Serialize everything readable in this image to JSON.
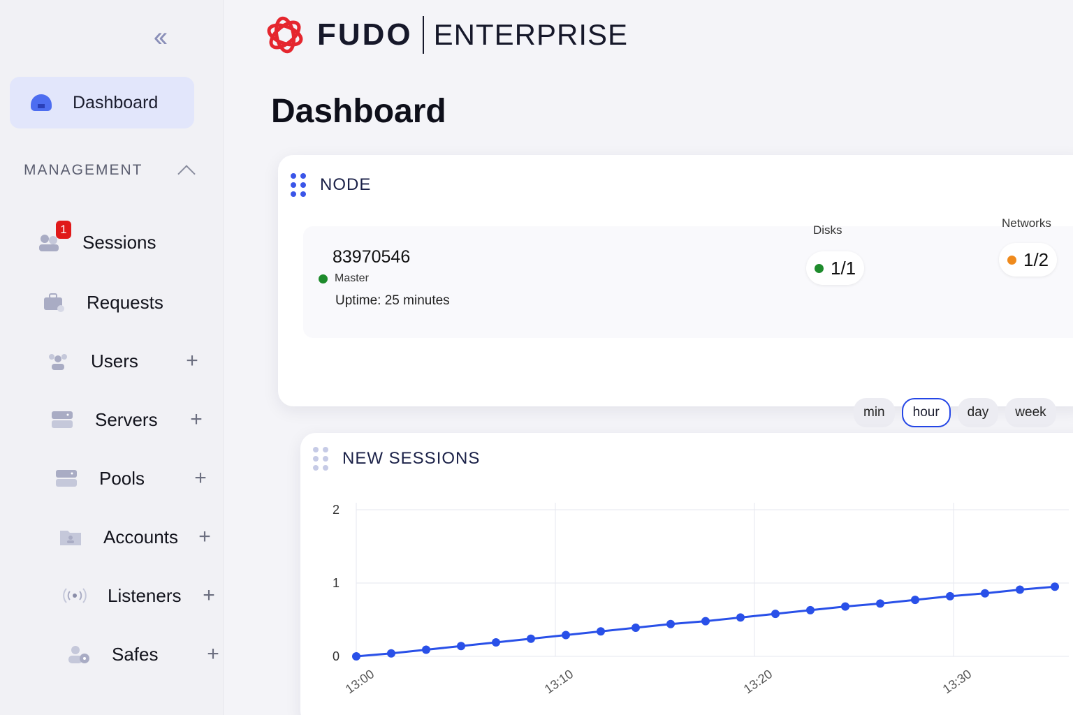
{
  "sidebar": {
    "dashboard_label": "Dashboard",
    "section_title": "MANAGEMENT",
    "items": [
      {
        "label": "Sessions",
        "badge": "1",
        "plus": ""
      },
      {
        "label": "Requests",
        "plus": ""
      },
      {
        "label": "Users",
        "plus": "+"
      },
      {
        "label": "Servers",
        "plus": "+"
      },
      {
        "label": "Pools",
        "plus": "+"
      },
      {
        "label": "Accounts",
        "plus": "+"
      },
      {
        "label": "Listeners",
        "plus": "+"
      },
      {
        "label": "Safes",
        "plus": "+"
      }
    ],
    "collapse_icon": "double-chevron-left-icon"
  },
  "header": {
    "brand": "FUDO",
    "edition": "ENTERPRISE",
    "accent": "#e5262e"
  },
  "page": {
    "title": "Dashboard"
  },
  "node": {
    "title": "NODE",
    "id": "83970546",
    "role": "Master",
    "uptime": "Uptime: 25 minutes",
    "disks_label": "Disks",
    "disks_value": "1/1",
    "disks_status": "#1e8b2c",
    "networks_label": "Networks",
    "networks_value": "1/2",
    "networks_status": "#ef8a1c"
  },
  "range": {
    "options": [
      "min",
      "hour",
      "day",
      "week"
    ],
    "selected": "hour"
  },
  "sessions": {
    "title": "NEW SESSIONS"
  },
  "chart_data": {
    "type": "line",
    "title": "NEW SESSIONS",
    "xlabel": "",
    "ylabel": "",
    "x_ticks": [
      "13:00",
      "13:10",
      "13:20",
      "13:30"
    ],
    "y_ticks": [
      0,
      1,
      2
    ],
    "ylim": [
      0,
      2
    ],
    "grid": true,
    "series_color": "#2950e8",
    "series": [
      {
        "values": [
          0,
          0.04,
          0.09,
          0.14,
          0.19,
          0.24,
          0.29,
          0.34,
          0.39,
          0.44,
          0.48,
          0.53,
          0.58,
          0.63,
          0.68,
          0.72,
          0.77,
          0.82,
          0.86,
          0.91,
          0.95
        ]
      }
    ]
  }
}
